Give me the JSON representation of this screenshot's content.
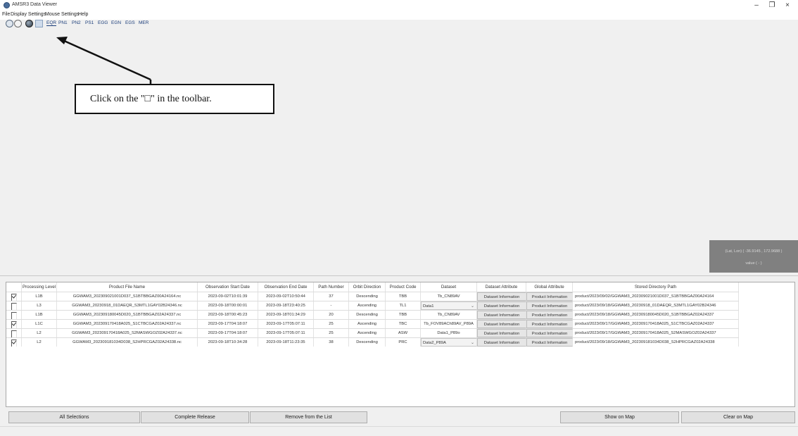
{
  "window": {
    "title": "AMSR3 Data Viewer",
    "controls": {
      "minimize": "–",
      "maximize": "❐",
      "close": "×"
    }
  },
  "menu": [
    "File",
    "Display Settings",
    "Mouse Settings",
    "Help"
  ],
  "toolbar": {
    "icons": [
      "clock-icon",
      "clock-outline-icon",
      "globe-icon",
      "square-select-icon"
    ],
    "projections": [
      "EQR",
      "PN1",
      "PN2",
      "PS1",
      "EGG",
      "EGN",
      "EGS",
      "MER"
    ],
    "active_projection": "EQR"
  },
  "callout": {
    "text": "Click on the \"□\" in the toolbar."
  },
  "coord_panel": {
    "latlon": "(Lat, Lon) ( -36.9145 , 172.9688 )",
    "value": "value ( - )"
  },
  "grid": {
    "columns": [
      "",
      "Processing Level",
      "Product File Name",
      "Observation Start Date",
      "Observation End Date",
      "Path Number",
      "Orbit Direction",
      "Product Code",
      "Dataset",
      "Dataset Attribute",
      "Global Attribute",
      "Stored Directory Path"
    ],
    "rows": [
      {
        "checked": true,
        "level": "L1B",
        "file": "GGWAM3_202309021001D037_S1BTBBGAZ00A24164.nc",
        "start": "2023-09-02T10:01:39",
        "end": "2023-09-02T10:50:44",
        "path": "37",
        "orbit": "Descending",
        "code": "TBB",
        "dataset": "Tb_CN89AV",
        "dataset_is_combo": false,
        "dataset_attr": "Dataset Information",
        "global_attr": "Product Information",
        "dir": "product/2023/09/02/GGWAM3_202309021001D037_S1BTBBGAZ00A24164"
      },
      {
        "checked": false,
        "level": "L3",
        "file": "GGWAM3_20230918_01DAEQR_S3MTL1GAY02B24346.nc",
        "start": "2023-09-18T00:00:01",
        "end": "2023-09-18T23:40:25",
        "path": "-",
        "orbit": "Ascending",
        "code": "TL1",
        "dataset": "Data1",
        "dataset_is_combo": true,
        "dataset_attr": "Dataset Information",
        "global_attr": "Product Information",
        "dir": "product/2023/09/18/GGWAM3_20230918_01DAEQR_S3MTL1GAY02B24346"
      },
      {
        "checked": false,
        "level": "L1B",
        "file": "GGWAM3_202309180045D020_S1BTBBGAZ02A24337.nc",
        "start": "2023-09-18T00:45:23",
        "end": "2023-09-18T01:34:29",
        "path": "20",
        "orbit": "Descending",
        "code": "TBB",
        "dataset": "Tb_CN89AV",
        "dataset_is_combo": false,
        "dataset_attr": "Dataset Information",
        "global_attr": "Product Information",
        "dir": "product/2023/09/18/GGWAM3_202309180045D020_S1BTBBGAZ02A24337"
      },
      {
        "checked": true,
        "level": "L1C",
        "file": "GGWAM3_202309170418A025_S1CTBCGAZ02A24337.nc",
        "start": "2023-09-17T04:18:07",
        "end": "2023-09-17T05:07:11",
        "path": "25",
        "orbit": "Ascending",
        "code": "TBC",
        "dataset": "Tb_FOV89ACh89AV_P89A",
        "dataset_is_combo": false,
        "dataset_attr": "Dataset Information",
        "global_attr": "Product Information",
        "dir": "product/2023/09/17/GGWAM3_202309170418A025_S1CTBCGAZ02A24337"
      },
      {
        "checked": false,
        "level": "L2",
        "file": "GGWAM3_202309170418A025_S2MASWGOZ02A24337.nc",
        "start": "2023-09-17T04:18:07",
        "end": "2023-09-17T05:07:11",
        "path": "25",
        "orbit": "Ascending",
        "code": "ASW",
        "dataset": "Data1_P89o",
        "dataset_is_combo": false,
        "dataset_attr": "Dataset Information",
        "global_attr": "Product Information",
        "dir": "product/2023/09/17/GGWAM3_202309170418A025_S2MASWGOZ02A24337"
      },
      {
        "checked": true,
        "level": "L2",
        "file": "GGWAM3_202309181034D038_S2HPRCGAZ02A24338.nc",
        "start": "2023-09-18T10:34:28",
        "end": "2023-09-18T11:23:35",
        "path": "38",
        "orbit": "Descending",
        "code": "PRC",
        "dataset": "Data2_P89A",
        "dataset_is_combo": true,
        "dataset_attr": "Dataset Information",
        "global_attr": "Product Information",
        "dir": "product/2023/09/18/GGWAM3_202309181034D038_S2HPRCGAZ02A24338"
      }
    ]
  },
  "buttons": {
    "all_selections": "All Selections",
    "complete_release": "Complete Release",
    "remove_from_list": "Remove from the List",
    "show_on_map": "Show on Map",
    "clear_on_map": "Clear on Map"
  }
}
